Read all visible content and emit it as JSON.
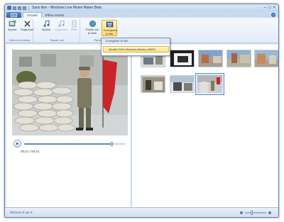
{
  "window": {
    "title": "Sans titre - Windows Live Movie Maker Beta"
  },
  "tabs": {
    "file": "",
    "items": [
      {
        "label": "Accueil"
      },
      {
        "label": "Effets visuels"
      }
    ]
  },
  "ribbon": {
    "groups": [
      {
        "label": "Vidéos et photos",
        "buttons": [
          "Ajouter",
          "Supprimer"
        ]
      },
      {
        "label": "Bande son",
        "buttons": [
          "Ajouter",
          "Supprimer",
          "Pilier"
        ]
      },
      {
        "label": "Partager",
        "buttons": [
          "Publier sur le Web",
          "Enregistrer le film"
        ]
      }
    ]
  },
  "menu": {
    "header": "Enregistrer le film",
    "item": "Qualité DVD Windows Media (.WMV)"
  },
  "player": {
    "time": "00:21 / 00:24",
    "progress": 0.875
  },
  "status": {
    "text": "Élément 8 sur 8"
  },
  "colors": {
    "accent": "#3b6fb8",
    "highlight": "#ffe27f"
  },
  "icons": [
    "add-clip-icon",
    "delete-icon",
    "add-music-icon",
    "remove-music-icon",
    "trim-icon",
    "publish-web-icon",
    "save-movie-icon",
    "play-icon",
    "zoom-out-icon",
    "zoom-in-icon",
    "help-icon"
  ]
}
